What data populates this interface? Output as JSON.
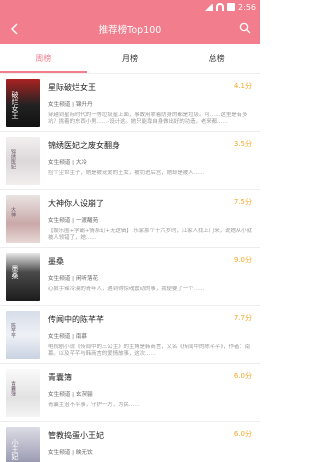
{
  "status": {
    "time": "2:56"
  },
  "header": {
    "title": "推荐榜Top100"
  },
  "tabs": [
    {
      "label": "周榜"
    },
    {
      "label": "月榜"
    },
    {
      "label": "总榜"
    }
  ],
  "books": [
    {
      "title": "星际破烂女王",
      "meta": "女生频道 | 锦升丹",
      "desc": "穿越到星际时代的一等垃圾星上面，事故用拿着防身的都是垃圾。可……这里是有多坑？挑着的东西小男……-设计这。她只能靠自身做出好的功造，老来都……",
      "score": "4.1分",
      "cover": "破烂女王"
    },
    {
      "title": "锦绣医妃之废女翻身",
      "meta": "女生频道 | 大冷",
      "desc": "捡个尘世主子，她是被宠爱的王女，被罚进后宫，她却是被人……",
      "score": "3.5分",
      "cover": "锦绣医妃"
    },
    {
      "title": "大神你人设崩了",
      "meta": "女生频道 | 一渡醒苑",
      "desc": "【娱乐圈+学霸+情系幻+无逻辑】\n乐家那个十六岁时，江家人找上门来，说她从小就被人领错了，她……",
      "score": "7.5分",
      "cover": "大神"
    },
    {
      "title": "墨桑",
      "meta": "女生频道 | 闲听落花",
      "desc": "心狠手辣冷漠的青年人，遇到得惊魂震动的事，我便要了一个……",
      "score": "9.0分",
      "cover": "墨桑"
    },
    {
      "title": "传闻中的陈芊芊",
      "meta": "女生频道 | 南慕",
      "desc": "电视剧小说《传闻中的三公主》的主角是韩商言，又名《传闻中的陈芊芊》，作者：南慕。以及芊芊与韩商言的爱情故事，这次……",
      "score": "7.7分",
      "cover": "陈芊芊"
    },
    {
      "title": "青囊簿",
      "meta": "女生频道 | 玄溟骊",
      "desc": "青囊主治不平事，守护一方，为民……",
      "score": "6.0分",
      "cover": "青囊簿"
    },
    {
      "title": "管教捣蛋小王妃",
      "meta": "女生频道 | 映无饮",
      "desc": "",
      "score": "6.0分",
      "cover": "小王妃"
    }
  ]
}
